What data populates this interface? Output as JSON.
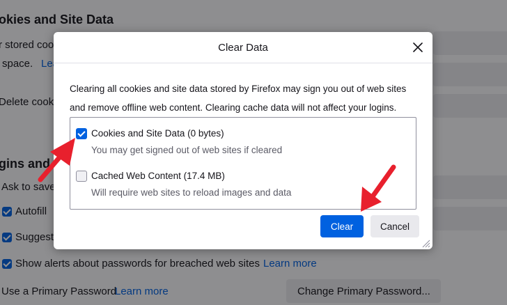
{
  "background": {
    "heading_cookies": "okies and Site Data",
    "text_stored": "r stored coo",
    "text_space": "space.",
    "link_learn_partial": "Lea",
    "text_delete": "Delete cook",
    "heading_logins": "gins and",
    "text_ask": "Ask to save",
    "text_autofill": "Autofill",
    "text_suggest": "Suggest",
    "text_alerts": "Show alerts about passwords for breached web sites",
    "link_learn_more_1": "Learn more",
    "text_primary_password": "Use a Primary Password",
    "link_learn_more_2": "Learn more",
    "btn_change_primary": "Change Primary Password..."
  },
  "dialog": {
    "title": "Clear Data",
    "description_line1": "Clearing all cookies and site data stored by Firefox may sign you out of web sites",
    "description_line2": "and remove offline web content. Clearing cache data will not affect your logins.",
    "options": [
      {
        "label": "Cookies and Site Data (0 bytes)",
        "sublabel": "You may get signed out of web sites if cleared",
        "checked": true
      },
      {
        "label": "Cached Web Content (17.4 MB)",
        "sublabel": "Will require web sites to reload images and data",
        "checked": false
      }
    ],
    "clear_button": "Clear",
    "cancel_button": "Cancel"
  },
  "colors": {
    "accent": "#0061e0",
    "annotation_arrow": "#e8202d"
  },
  "icons": [
    "close-icon",
    "checkbox-checked-icon",
    "checkbox-unchecked-icon",
    "resize-grip-icon",
    "annotation-arrow-icon"
  ]
}
